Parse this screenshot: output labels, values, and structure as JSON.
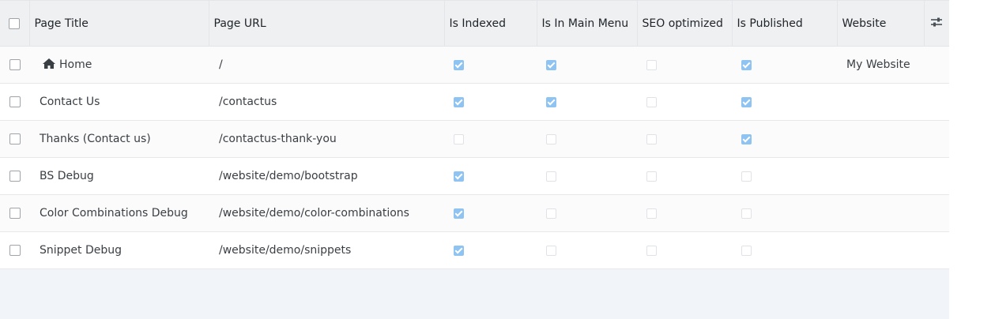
{
  "columns": {
    "page_title": "Page Title",
    "page_url": "Page URL",
    "is_indexed": "Is Indexed",
    "in_main_menu": "Is In Main Menu",
    "seo_optimized": "SEO optimized",
    "is_published": "Is Published",
    "website": "Website"
  },
  "icons": {
    "home": "home-icon",
    "optional_columns": "sliders-icon"
  },
  "colors": {
    "checked": "#8fc3f2",
    "header_bg": "#eef0f2",
    "empty_area": "#f1f5f9"
  },
  "rows": [
    {
      "title": "Home",
      "url": "/",
      "is_indexed": true,
      "in_main_menu": true,
      "seo_optimized": false,
      "is_published": true,
      "website": "My Website",
      "home": true
    },
    {
      "title": "Contact Us",
      "url": "/contactus",
      "is_indexed": true,
      "in_main_menu": true,
      "seo_optimized": false,
      "is_published": true,
      "website": ""
    },
    {
      "title": "Thanks (Contact us)",
      "url": "/contactus-thank-you",
      "is_indexed": false,
      "in_main_menu": false,
      "seo_optimized": false,
      "is_published": true,
      "website": ""
    },
    {
      "title": "BS Debug",
      "url": "/website/demo/bootstrap",
      "is_indexed": true,
      "in_main_menu": false,
      "seo_optimized": false,
      "is_published": false,
      "website": ""
    },
    {
      "title": "Color Combinations Debug",
      "url": "/website/demo/color-combinations",
      "is_indexed": true,
      "in_main_menu": false,
      "seo_optimized": false,
      "is_published": false,
      "website": ""
    },
    {
      "title": "Snippet Debug",
      "url": "/website/demo/snippets",
      "is_indexed": true,
      "in_main_menu": false,
      "seo_optimized": false,
      "is_published": false,
      "website": ""
    }
  ]
}
